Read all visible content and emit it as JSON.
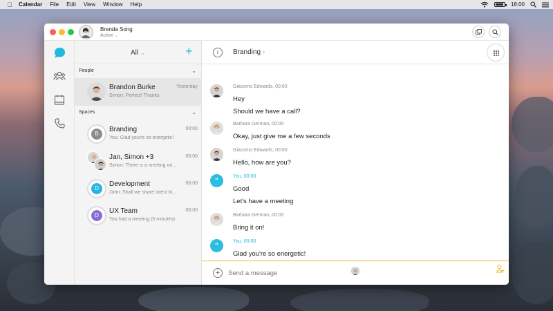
{
  "menubar": {
    "app": "Calendar",
    "items": [
      "File",
      "Edit",
      "View",
      "Window",
      "Help"
    ],
    "clock": "18:00"
  },
  "titlebar": {
    "user_name": "Brenda Song",
    "user_status": "Active"
  },
  "list": {
    "filter_label": "All",
    "sections": {
      "people": "People",
      "spaces": "Spaces"
    },
    "people": [
      {
        "title": "Brandon Burke",
        "subtitle": "Simon: Perfect! Thanks.",
        "time": "Yesterday"
      }
    ],
    "spaces": [
      {
        "title": "Branding",
        "subtitle": "You: Glad you're so energetic!",
        "time": "00:00",
        "letter": "B",
        "color": "#8c8c8c"
      },
      {
        "title": "Jan, Simon +3",
        "subtitle": "Simon: There is a meeting on...",
        "time": "00:00"
      },
      {
        "title": "Development",
        "subtitle": "John: Shall we share latest fil...",
        "time": "00:00",
        "letter": "D",
        "color": "#25b6e2"
      },
      {
        "title": "UX Team",
        "subtitle": "You had a meeting (5 minutes)",
        "time": "00:00",
        "letter": "D",
        "color": "#8a6fd6"
      }
    ]
  },
  "conversation": {
    "title": "Branding",
    "messages": [
      {
        "meta": "Giacomo Edwards, 00:00",
        "lines": [
          "Hey",
          "Should we have a call?"
        ]
      },
      {
        "meta": "Barbara German, 00:00",
        "lines": [
          "Okay, just give me a few seconds"
        ]
      },
      {
        "meta": "Giacomo Edwards, 00:00",
        "lines": [
          "Hello, how are you?"
        ]
      },
      {
        "meta": "You, 00:00",
        "lines": [
          "Good",
          "Let's have a meeting"
        ]
      },
      {
        "meta": "Barbara German, 00:00",
        "lines": [
          "Bring it on!"
        ]
      },
      {
        "meta": "You, 00:00",
        "lines": [
          "Glad you're so energetic!"
        ]
      }
    ],
    "composer_placeholder": "Send a message"
  },
  "colors": {
    "accent": "#25b6e2",
    "composer_line": "#f1b52b"
  }
}
